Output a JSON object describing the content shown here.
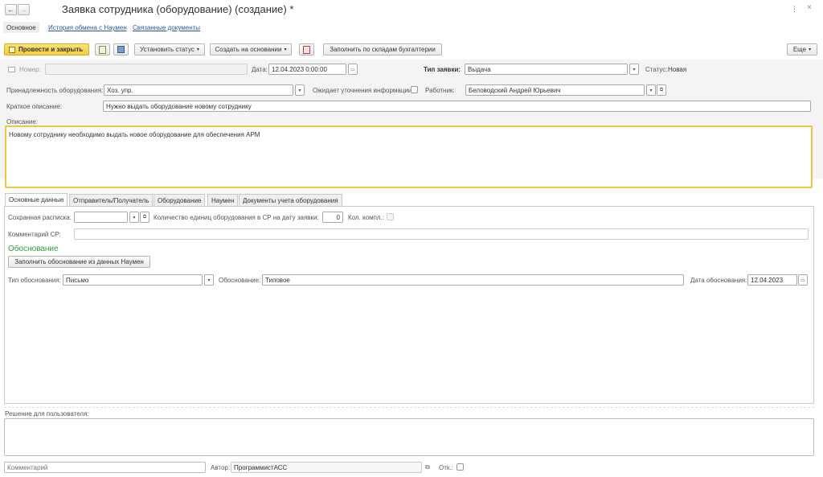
{
  "window": {
    "title": "Заявка сотрудника (оборудование) (создание) *"
  },
  "nav": {
    "back": "←",
    "forward": "→",
    "more": "⋮",
    "close": "×"
  },
  "form_tabs": [
    "Основное",
    "История обмена с Наумен",
    "Связанные документы"
  ],
  "toolbar": {
    "post_close": "Провести и закрыть",
    "set_status": "Установить статус",
    "create_based": "Создать на основании",
    "fill_by_warehouses": "Заполнить по складам бухгалтерии",
    "more": "Еще"
  },
  "header": {
    "number_label": "Номер:",
    "number_value": "",
    "date_label": "Дата:",
    "date_value": "12.04.2023  0:00:00",
    "request_type_label": "Тип заявки:",
    "request_type_value": "Выдача",
    "status_label": "Статус:",
    "status_value": "Новая",
    "ownership_label": "Принадлежность оборудования:",
    "ownership_value": "Хоз. упр.",
    "awaiting_label": "Ожидает уточнения информации:",
    "awaiting_checked": false,
    "employee_label": "Работник:",
    "employee_value": "Беловодский Андрей Юрьевич",
    "short_desc_label": "Краткое описание:",
    "short_desc_value": "Нужно выдать оборудование новому сотруднику",
    "desc_label": "Описание:",
    "desc_value": "Новому сотруднику необходимо выдать новое оборудование для обеспечения АРМ"
  },
  "inner_tabs": [
    "Основные данные",
    "Отправитель/Получатель",
    "Оборудование",
    "Наумен",
    "Документы учета оборудования"
  ],
  "main": {
    "receipt_label": "Сохранная расписка:",
    "receipt_value": "",
    "qty_label": "Количество единиц оборудования в СР на дату заявки:",
    "qty_value": "0",
    "kit_label": "Кол. компл.:",
    "comment_sr_label": "Комментарий СР:",
    "comment_sr_value": "",
    "justification_heading": "Обоснование",
    "fill_justification_btn": "Заполнить обоснование из данных Наумен",
    "just_type_label": "Тип обоснования:",
    "just_type_value": "Письмо",
    "justification_label": "Обоснование:",
    "justification_value": "Типовое",
    "just_date_label": "Дата обоснования:",
    "just_date_value": "12.04.2023"
  },
  "footer": {
    "decision_label": "Решение для пользователя:",
    "decision_value": "",
    "comment_placeholder": "Комментарий",
    "author_label": "Автор:",
    "author_value": "ПрограммистАСС",
    "responsible_label": "Отк.:"
  },
  "colors": {
    "accent_yellow": "#f5d44a",
    "link_blue": "#2b5a9e",
    "heading_green": "#2f9e44",
    "focus_border": "#f0c640"
  }
}
